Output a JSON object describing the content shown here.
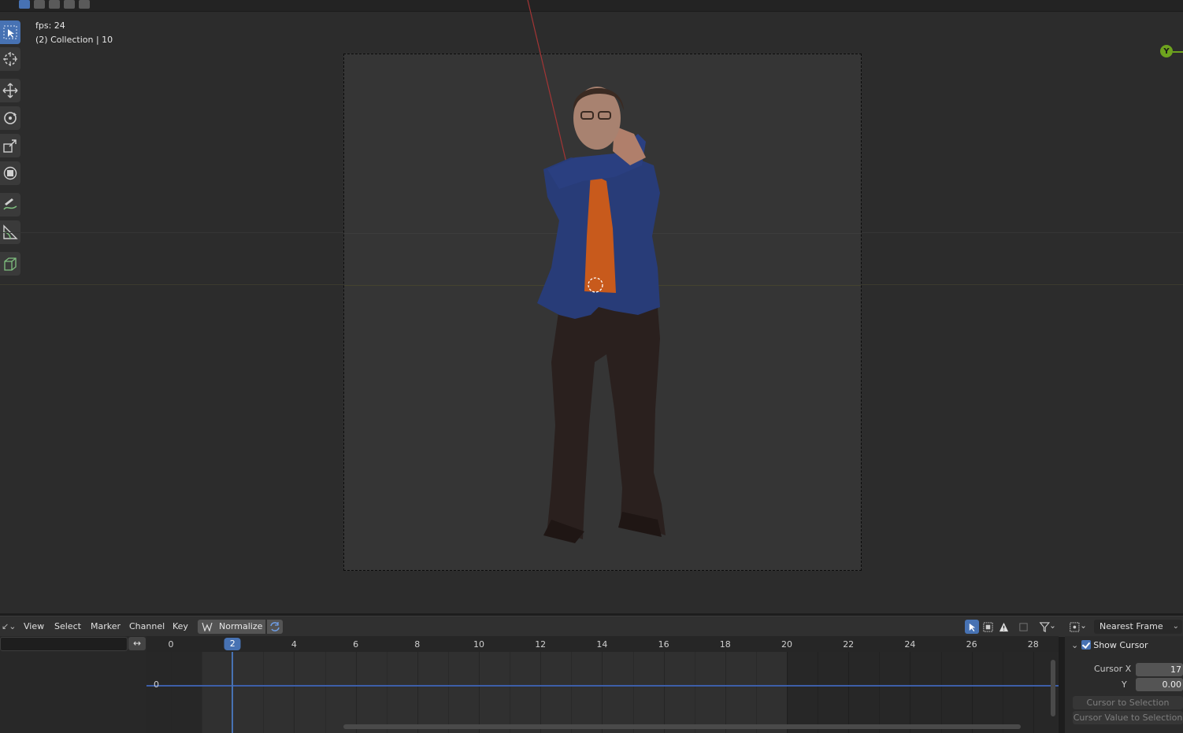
{
  "viewport": {
    "overlay": {
      "fps": "fps: 24",
      "collection": "(2) Collection | 10"
    },
    "gizmo": {
      "y_axis": "Y",
      "y_color": "#6ea31e"
    },
    "tools": [
      "select-box",
      "cursor",
      "move",
      "rotate",
      "scale",
      "transform",
      "annotate",
      "measure",
      "add-cube"
    ]
  },
  "graph_editor": {
    "menu": {
      "view": "View",
      "select": "Select",
      "marker": "Marker",
      "channel": "Channel",
      "key": "Key"
    },
    "normalize_label": "Normalize",
    "snap_mode": "Nearest Frame",
    "frame_ticks": [
      "0",
      "2",
      "4",
      "6",
      "8",
      "10",
      "12",
      "14",
      "16",
      "18",
      "20",
      "22",
      "24",
      "26",
      "28"
    ],
    "current_frame": "2",
    "y_axis_label": "0",
    "side_panel": {
      "show_cursor_label": "Show Cursor",
      "show_cursor_checked": true,
      "cursor_x_label": "Cursor X",
      "cursor_x_value": "17",
      "cursor_y_label": "Y",
      "cursor_y_value": "0.00",
      "cursor_to_selection": "Cursor to Selection",
      "cursor_value_to_selection": "Cursor Value to Selection"
    },
    "accent_color": "#4772b3"
  }
}
